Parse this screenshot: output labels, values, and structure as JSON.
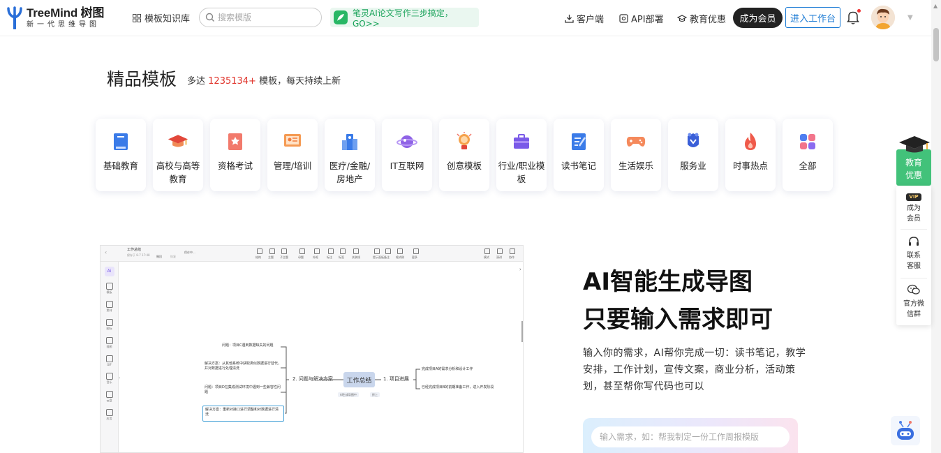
{
  "header": {
    "logo_title": "TreeMind 树图",
    "logo_sub": "新一代思维导图",
    "nav_library": "模板知识库",
    "search_placeholder": "搜索模版",
    "promo_text": "笔灵AI论文写作三步搞定，GO>>",
    "client": "客户端",
    "api": "API部署",
    "edu": "教育优惠",
    "vip_button": "成为会员",
    "workspace_button": "进入工作台"
  },
  "section": {
    "title": "精品模板",
    "sub_prefix": "多达",
    "count": "1235134+",
    "sub_suffix": "模板，每天持续上新"
  },
  "categories": [
    {
      "label": "基础教育",
      "icon": "book-icon"
    },
    {
      "label": "高校与高等教育",
      "icon": "graduation-cap-icon"
    },
    {
      "label": "资格考试",
      "icon": "certificate-icon"
    },
    {
      "label": "管理/培训",
      "icon": "presentation-icon"
    },
    {
      "label": "医疗/金融/房地产",
      "icon": "building-icon"
    },
    {
      "label": "IT互联网",
      "icon": "planet-icon"
    },
    {
      "label": "创意模板",
      "icon": "lightbulb-icon"
    },
    {
      "label": "行业/职业模板",
      "icon": "briefcase-icon"
    },
    {
      "label": "读书笔记",
      "icon": "notebook-icon"
    },
    {
      "label": "生活娱乐",
      "icon": "gamepad-icon"
    },
    {
      "label": "服务业",
      "icon": "service-icon"
    },
    {
      "label": "时事热点",
      "icon": "flame-icon"
    },
    {
      "label": "全部",
      "icon": "grid-icon"
    }
  ],
  "preview": {
    "doc_title": "工作总结",
    "doc_meta": "保存于 8-7 17:48",
    "undo": "撤回",
    "redo": "恢复",
    "save_status": "保存中...",
    "toolbar": [
      "结构",
      "主题",
      "子主题",
      "母题",
      "外框",
      "标注",
      "标签",
      "关联线",
      "提示面板",
      "备注",
      "格式刷",
      "更多"
    ],
    "toolbar_right": [
      "模式",
      "演讲",
      "协作"
    ],
    "side": [
      "模板",
      "素材",
      "图标",
      "插图",
      "GIF",
      "音乐",
      "云盘",
      "应用"
    ],
    "root": "工作总结",
    "branch_left": "2. 问题与解决方案",
    "branch_right": "1. 项目进展",
    "left_nodes": [
      "问题：项目C遇到数据缺失的问题",
      "解决方案：从其他系统中获取类似数据进行替代，并对数据进行处理清洗",
      "问题：项目D在集成测试环境中遇到一些兼容性问题",
      "解决方案：重新对接口进行调整和对数据进行清洗"
    ],
    "right_nodes": [
      "完成项目A的需求分析和设计工作",
      "已经完成项目B的前期准备工作，进入开发阶段"
    ],
    "ai_tag": "AI生成导图中",
    "fold": "折上"
  },
  "ai": {
    "h1": "AI智能生成导图",
    "h2": "只要输入需求即可",
    "desc": "输入你的需求，AI帮你完成一切：读书笔记，教学安排，工作计划，宣传文案，商业分析，活动策划，甚至帮你写代码也可以",
    "input_placeholder": "输入需求，如：帮我制定一份工作周报模版"
  },
  "right_panel": {
    "edu": "教育优惠",
    "vip_badge": "VIP",
    "vip": "成为会员",
    "contact": "联系客服",
    "wechat": "官方微信群"
  }
}
